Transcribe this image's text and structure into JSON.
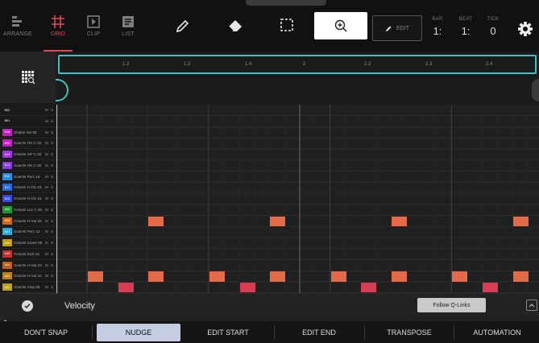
{
  "toolbar": {
    "modes": [
      {
        "label": "ARRANGE",
        "icon": "arrange-icon"
      },
      {
        "label": "GRID",
        "icon": "grid-icon"
      },
      {
        "label": "CLIP",
        "icon": "clip-icon"
      },
      {
        "label": "LIST",
        "icon": "list-icon"
      }
    ],
    "active_mode": "GRID",
    "tools": [
      "pencil-icon",
      "eraser-icon",
      "select-icon",
      "zoom-icon"
    ],
    "edit_label": "EDIT",
    "position": {
      "bar_label": "BAR",
      "bar_value": "1:",
      "beat_label": "BEAT",
      "beat_value": "1:",
      "tick_label": "TICK",
      "tick_value": "0"
    }
  },
  "ruler": {
    "labels": [
      "1.2",
      "1.3",
      "1.4",
      "2",
      "2.2",
      "2.3",
      "2.4"
    ]
  },
  "tracks": [
    {
      "code": "B02",
      "name": "",
      "color": "#1a1a1a"
    },
    {
      "code": "B01",
      "name": "",
      "color": "#1a1a1a"
    },
    {
      "code": "B16",
      "name": "Shaker Mn 86",
      "color": "#c020c0"
    },
    {
      "code": "B15",
      "name": "SoarHs HH C 04",
      "color": "#c020c0"
    },
    {
      "code": "B14",
      "name": "OctaHs HH C 03",
      "color": "#a030e0"
    },
    {
      "code": "B13",
      "name": "SoarHs HH C 02",
      "color": "#8a3ae0"
    },
    {
      "code": "B12",
      "name": "SoarHs Perc 15",
      "color": "#2a8ae0"
    },
    {
      "code": "B11",
      "name": "OctaHs H Clo 16",
      "color": "#2a6ae0"
    },
    {
      "code": "B10",
      "name": "OctaHs H Clo 15",
      "color": "#3a4ae0"
    },
    {
      "code": "A09",
      "name": "OctaHs Loc C 06",
      "color": "#1a9a30"
    },
    {
      "code": "A08",
      "name": "OctaHs H Hat 26",
      "color": "#d06a10"
    },
    {
      "code": "B07",
      "name": "SoarHs Perc 13",
      "color": "#2aaae0"
    },
    {
      "code": "A06",
      "name": "OctaHs Snare 08",
      "color": "#c0a010"
    },
    {
      "code": "A05",
      "name": "OctaHs Kick 16",
      "color": "#c03030"
    },
    {
      "code": "A04",
      "name": "SoarHs H Hat 23",
      "color": "#c06010"
    },
    {
      "code": "A03",
      "name": "OctaHs H Hat 22",
      "color": "#c08010"
    },
    {
      "code": "A02",
      "name": "SoarHs Clap 08",
      "color": "#c0a020"
    }
  ],
  "notes": [
    {
      "row": 10,
      "step": 3,
      "color": "#e46a4a"
    },
    {
      "row": 10,
      "step": 7,
      "color": "#e46a4a"
    },
    {
      "row": 10,
      "step": 11,
      "color": "#e46a4a"
    },
    {
      "row": 10,
      "step": 15,
      "color": "#e46a4a"
    },
    {
      "row": 15,
      "step": 1,
      "color": "#e46a4a"
    },
    {
      "row": 15,
      "step": 3,
      "color": "#e46a4a"
    },
    {
      "row": 15,
      "step": 5,
      "color": "#e46a4a"
    },
    {
      "row": 15,
      "step": 7,
      "color": "#e46a4a"
    },
    {
      "row": 15,
      "step": 9,
      "color": "#e46a4a"
    },
    {
      "row": 15,
      "step": 11,
      "color": "#e46a4a"
    },
    {
      "row": 15,
      "step": 13,
      "color": "#e46a4a"
    },
    {
      "row": 15,
      "step": 15,
      "color": "#e46a4a"
    },
    {
      "row": 16,
      "step": 2,
      "color": "#d63c52"
    },
    {
      "row": 16,
      "step": 6,
      "color": "#d63c52"
    },
    {
      "row": 16,
      "step": 10,
      "color": "#d63c52"
    },
    {
      "row": 16,
      "step": 14,
      "color": "#d63c52"
    }
  ],
  "lane": {
    "label": "Velocity",
    "follow_label": "Follow Q-Links"
  },
  "bottom": {
    "buttons": [
      "DON'T SNAP",
      "NUDGE",
      "EDIT START",
      "EDIT END",
      "TRANSPOSE",
      "AUTOMATION"
    ],
    "active": "NUDGE"
  },
  "colors": {
    "accent_grid": "#e2475a",
    "loop_cyan": "#3cc3c3",
    "note_orange": "#e46a4a",
    "note_red": "#d63c52"
  }
}
